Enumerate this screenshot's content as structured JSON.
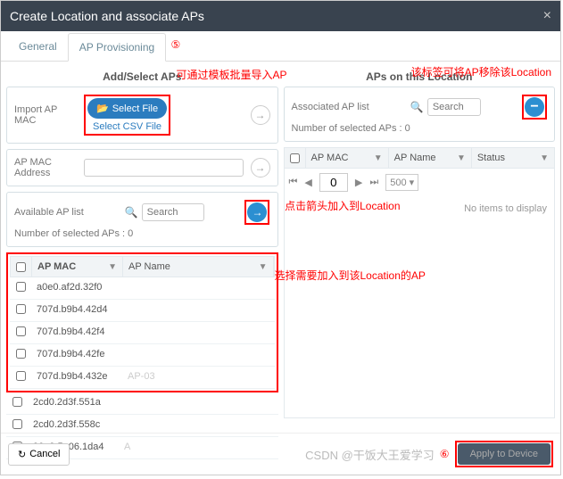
{
  "title": "Create Location and associate APs",
  "tabs": {
    "general": "General",
    "provisioning": "AP Provisioning"
  },
  "circ5": "⑤",
  "circ6": "⑥",
  "left": {
    "title": "Add/Select APs",
    "import_label": "Import AP MAC",
    "select_file": "Select File",
    "select_csv": "Select CSV File",
    "mac_label": "AP MAC Address",
    "avail_label": "Available AP list",
    "search_ph": "Search",
    "count": "Number of selected APs : 0",
    "cols": {
      "mac": "AP MAC",
      "name": "AP Name"
    },
    "rows": [
      {
        "mac": "a0e0.af2d.32f0",
        "name": ""
      },
      {
        "mac": "707d.b9b4.42d4",
        "name": ""
      },
      {
        "mac": "707d.b9b4.42f4",
        "name": ""
      },
      {
        "mac": "707d.b9b4.42fe",
        "name": ""
      },
      {
        "mac": "707d.b9b4.432e",
        "name": "AP-03"
      },
      {
        "mac": "2cd0.2d3f.551a",
        "name": ""
      },
      {
        "mac": "2cd0.2d3f.558c",
        "name": ""
      },
      {
        "mac": "90e9.5e06.1da4",
        "name": "A"
      }
    ]
  },
  "right": {
    "title": "APs on this Location",
    "assoc_label": "Associated AP list",
    "search_ph": "Search",
    "count": "Number of selected APs : 0",
    "cols": {
      "mac": "AP MAC",
      "name": "AP Name",
      "status": "Status"
    },
    "pager_page": "0",
    "pager_size": "500 ▾",
    "no_items": "No items to display"
  },
  "annot": {
    "import": "可通过模板批量导入AP",
    "remove": "该标签可将AP移除该Location",
    "arrow": "点击箭头加入到Location",
    "select": "选择需要加入到该Location的AP"
  },
  "footer": {
    "cancel": "Cancel",
    "apply": "Apply to Device"
  },
  "watermark": "CSDN @干饭大王爱学习"
}
